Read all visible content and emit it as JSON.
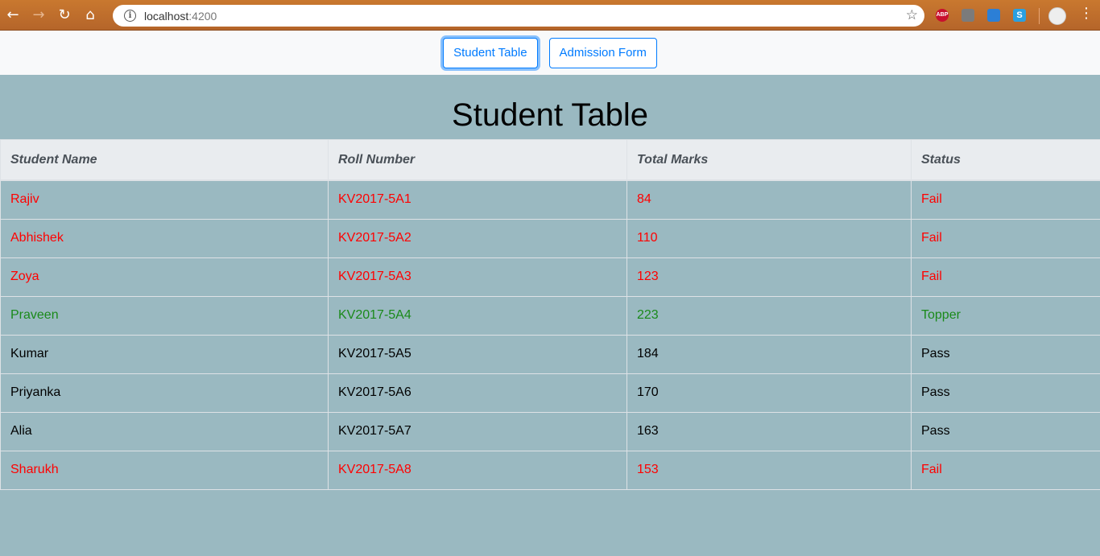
{
  "browser": {
    "url_host": "localhost",
    "url_port": ":4200",
    "extensions": [
      "ABP",
      "",
      "",
      "S"
    ]
  },
  "nav": {
    "student_table": "Student Table",
    "admission_form": "Admission Form"
  },
  "page_title": "Student Table",
  "table": {
    "headers": [
      "Student Name",
      "Roll Number",
      "Total Marks",
      "Status"
    ],
    "rows": [
      {
        "name": "Rajiv",
        "roll": "KV2017-5A1",
        "marks": "84",
        "status": "Fail"
      },
      {
        "name": "Abhishek",
        "roll": "KV2017-5A2",
        "marks": "110",
        "status": "Fail"
      },
      {
        "name": "Zoya",
        "roll": "KV2017-5A3",
        "marks": "123",
        "status": "Fail"
      },
      {
        "name": "Praveen",
        "roll": "KV2017-5A4",
        "marks": "223",
        "status": "Topper"
      },
      {
        "name": "Kumar",
        "roll": "KV2017-5A5",
        "marks": "184",
        "status": "Pass"
      },
      {
        "name": "Priyanka",
        "roll": "KV2017-5A6",
        "marks": "170",
        "status": "Pass"
      },
      {
        "name": "Alia",
        "roll": "KV2017-5A7",
        "marks": "163",
        "status": "Pass"
      },
      {
        "name": "Sharukh",
        "roll": "KV2017-5A8",
        "marks": "153",
        "status": "Fail"
      }
    ]
  },
  "colors": {
    "fail": "#ff0000",
    "topper": "#1a8a1a",
    "pass": "#000000",
    "page_bg": "#9ab9c1",
    "accent": "#007bff"
  }
}
